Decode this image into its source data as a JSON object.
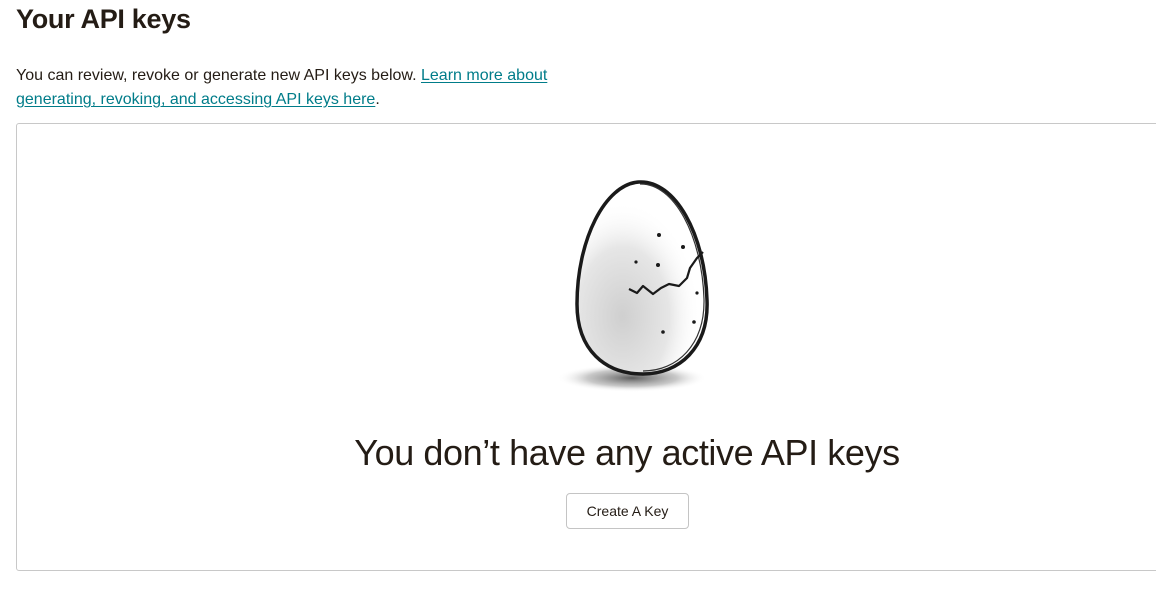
{
  "header": {
    "title": "Your API keys"
  },
  "intro": {
    "text": "You can review, revoke or generate new API keys below.",
    "link_text": "Learn more about generating, revoking, and accessing API keys here",
    "trailing": "."
  },
  "empty_state": {
    "illustration_icon": "cracked-egg-icon",
    "heading": "You don’t have any active API keys",
    "create_button_label": "Create A Key"
  },
  "colors": {
    "link": "#007c89",
    "text": "#241c15",
    "panel_border": "#c8c8c8"
  }
}
